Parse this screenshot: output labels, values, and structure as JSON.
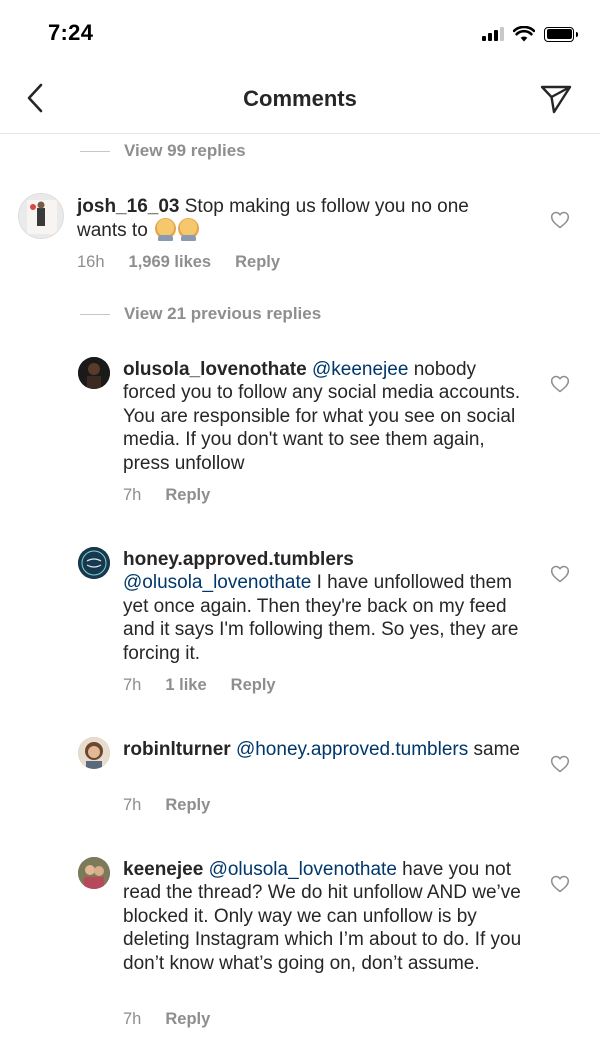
{
  "status": {
    "time": "7:24"
  },
  "header": {
    "title": "Comments"
  },
  "threads": [
    {
      "view_text": "View 99 replies"
    }
  ],
  "comments": [
    {
      "username": "josh_16_03",
      "mention": "",
      "text": "Stop making us follow you no one wants to",
      "emoji": [
        "facepalm-emoji",
        "facepalm-emoji"
      ],
      "time": "16h",
      "likes": "1,969 likes",
      "reply": "Reply"
    },
    {
      "view_text": "View 21 previous replies"
    },
    {
      "username": "olusola_lovenothate",
      "mention": "@keenejee",
      "text": "nobody forced you to follow any social media accounts. You are responsible for what you see on social media. If you don't want to see them again, press unfollow",
      "time": "7h",
      "likes": "",
      "reply": "Reply"
    },
    {
      "username": "honey.approved.tumblers",
      "mention": "@olusola_lovenothate",
      "text": "I have unfollowed them yet once again. Then they're back on my feed and it says I'm following them. So yes, they are forcing it.",
      "time": "7h",
      "likes": "1 like",
      "reply": "Reply"
    },
    {
      "username": "robinlturner",
      "mention": "@honey.approved.tumblers",
      "text": "same",
      "time": "7h",
      "likes": "",
      "reply": "Reply"
    },
    {
      "username": "keenejee",
      "mention": "@olusola_lovenothate",
      "text": "have you not read the thread? We do hit unfollow AND we’ve blocked it. Only way we can unfollow is by deleting Instagram which I’m about to do. If you don’t know what’s going on, don’t assume.",
      "time": "7h",
      "likes": "",
      "reply": "Reply"
    }
  ],
  "colors": {
    "mention": "#00376b",
    "meta": "#8e8e8e",
    "text": "#262626"
  }
}
